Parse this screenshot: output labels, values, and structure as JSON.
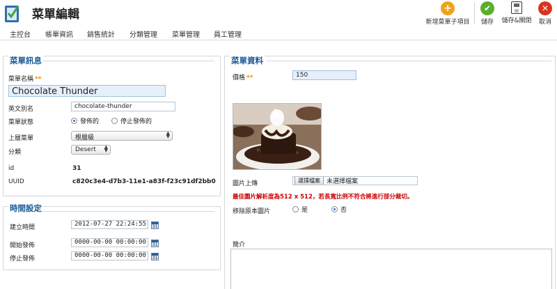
{
  "header": {
    "title": "菜單編輯"
  },
  "toolbar": {
    "new_sub": "新增菜單子項目",
    "save": "儲存",
    "save_close": "儲存&關閉",
    "cancel": "取消"
  },
  "nav": [
    "主控台",
    "帳單資訊",
    "銷售統計",
    "分類管理",
    "菜單管理",
    "員工管理"
  ],
  "menu_info": {
    "title": "菜單訊息",
    "name_label": "菜單名稱",
    "required_mark": "**",
    "name_value": "Chocolate Thunder",
    "alias_label": "英文別名",
    "alias_value": "chocolate-thunder",
    "status_label": "菜單狀態",
    "status_published": "發佈的",
    "status_unpublished": "停止發佈的",
    "parent_label": "上層菜單",
    "parent_value": "根層級",
    "category_label": "分類",
    "category_value": "Desert",
    "id_label": "id",
    "id_value": "31",
    "uuid_label": "UUID",
    "uuid_value": "c820c3e4-d7b3-11e1-a83f-f23c91df2bb0"
  },
  "time_settings": {
    "title": "時間設定",
    "created_label": "建立時間",
    "created_value": "2012-07-27 22:24:55",
    "publish_start_label": "開始發佈",
    "publish_start_value": "0000-00-00 00:00:00",
    "publish_end_label": "停止發佈",
    "publish_end_value": "0000-00-00 00:00:00",
    "calendar_glyph": "31"
  },
  "menu_data": {
    "title": "菜單資料",
    "price_label": "價格",
    "required_mark": "**",
    "price_value": "150",
    "upload_label": "圖片上傳",
    "choose_file": "選擇檔案",
    "no_file": "未選擇檔案",
    "warning": "最佳圖片解析度為512 x 512，若長寬比例不符合將進行部分裁切。",
    "remove_label": "移除原本圖片",
    "remove_yes": "是",
    "remove_no": "否",
    "intro_label": "簡介"
  },
  "colors": {
    "accent": "#1a5a96",
    "required": "#f08a00",
    "warning": "#cc0000",
    "new_icon": "#f0a21c",
    "save_icon": "#5aae2e",
    "cancel_icon": "#d9341f"
  }
}
